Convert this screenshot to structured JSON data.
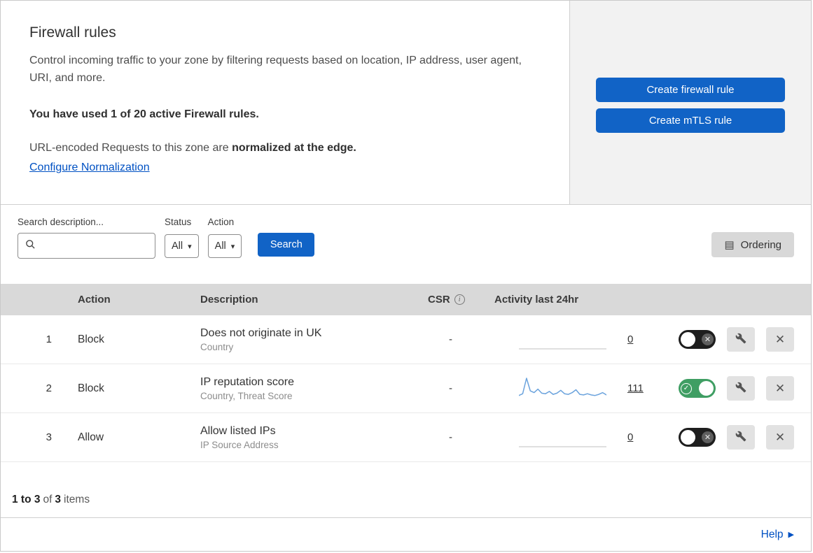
{
  "overview": {
    "title": "Firewall rules",
    "description": "Control incoming traffic to your zone by filtering requests based on location, IP address, user agent, URI, and more.",
    "usage": "You have used 1 of 20 active Firewall rules.",
    "normalization": {
      "text": "URL-encoded Requests to this zone are",
      "bold": "normalized at the edge.",
      "link": "Configure Normalization"
    },
    "actions": {
      "create_firewall_rule": "Create firewall rule",
      "create_mtls_rule": "Create mTLS rule"
    }
  },
  "filters": {
    "search_label": "Search description...",
    "status": {
      "label": "Status",
      "value": "All"
    },
    "action": {
      "label": "Action",
      "value": "All"
    },
    "search_button": "Search",
    "ordering_button": "Ordering"
  },
  "table": {
    "headers": {
      "action": "Action",
      "description": "Description",
      "csr": "CSR",
      "activity": "Activity last 24hr"
    },
    "rows": [
      {
        "index": "1",
        "action": "Block",
        "description": "Does not originate in UK",
        "criteria": "Country",
        "csr": "-",
        "activity_count": "0",
        "enabled": false,
        "sparkline": [
          0,
          0,
          0,
          0,
          0,
          0,
          0,
          0,
          0,
          0,
          0,
          0
        ]
      },
      {
        "index": "2",
        "action": "Block",
        "description": "IP reputation score",
        "criteria": "Country, Threat Score",
        "csr": "-",
        "activity_count": "111",
        "enabled": true,
        "sparkline": [
          4,
          7,
          34,
          12,
          9,
          15,
          8,
          7,
          11,
          6,
          8,
          13,
          7,
          6,
          9,
          14,
          6,
          5,
          7,
          5,
          4,
          6,
          9,
          5
        ]
      },
      {
        "index": "3",
        "action": "Allow",
        "description": "Allow listed IPs",
        "criteria": "IP Source Address",
        "csr": "-",
        "activity_count": "0",
        "enabled": false,
        "sparkline": [
          0,
          0,
          0,
          0,
          0,
          0,
          0,
          0,
          0,
          0,
          0,
          0
        ]
      }
    ],
    "summary": {
      "range": "1 to 3",
      "of": "of",
      "total": "3",
      "items": "items"
    }
  },
  "footer": {
    "help": "Help"
  },
  "colors": {
    "primary_button": "#1163c6",
    "link": "#0051c3",
    "toggle_on": "#3f9e63",
    "toggle_off": "#1e1e1e",
    "sparkline": "#6ba3dd"
  }
}
